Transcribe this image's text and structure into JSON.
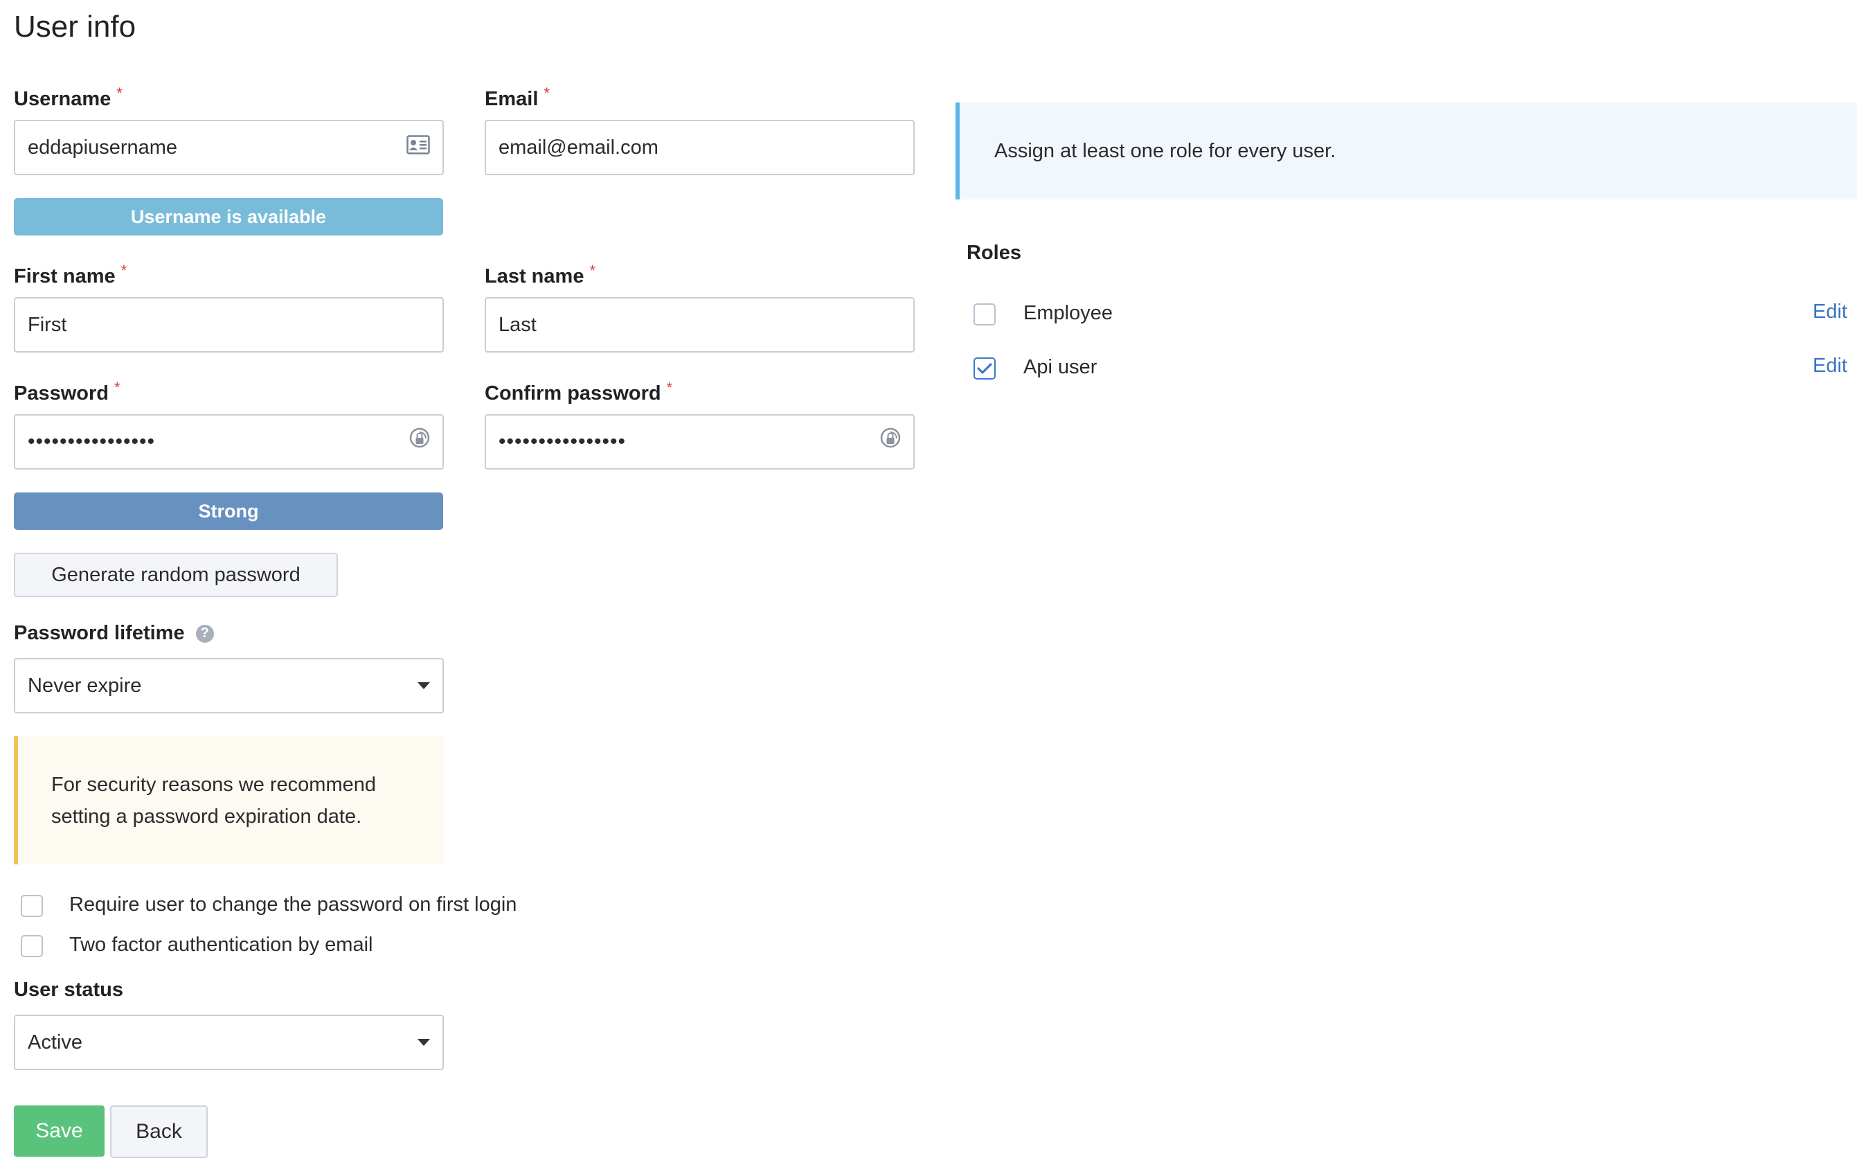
{
  "page": {
    "title": "User info"
  },
  "form": {
    "username": {
      "label": "Username",
      "value": "eddapiusername",
      "status": "Username is available"
    },
    "email": {
      "label": "Email",
      "value": "email@email.com"
    },
    "first_name": {
      "label": "First name",
      "value": "First"
    },
    "last_name": {
      "label": "Last name",
      "value": "Last"
    },
    "password": {
      "label": "Password",
      "value": "••••••••••••••••",
      "strength": "Strong"
    },
    "confirm_password": {
      "label": "Confirm password",
      "value": "••••••••••••••••"
    },
    "required_marker": "*",
    "generate_button": "Generate random password",
    "password_lifetime": {
      "label": "Password lifetime",
      "help_icon": "?",
      "selected": "Never expire"
    },
    "security_note_line1": "For security reasons we recommend",
    "security_note_line2": "setting a password expiration date.",
    "require_change": {
      "label": "Require user to change the password on first login",
      "checked": false
    },
    "two_factor": {
      "label": "Two factor authentication by email",
      "checked": false
    },
    "user_status": {
      "label": "User status",
      "selected": "Active"
    },
    "save_button": "Save",
    "back_button": "Back"
  },
  "roles_panel": {
    "info": "Assign at least one role for every user.",
    "title": "Roles",
    "roles": [
      {
        "name": "Employee",
        "checked": false,
        "edit_label": "Edit"
      },
      {
        "name": "Api user",
        "checked": true,
        "edit_label": "Edit"
      }
    ]
  },
  "colors": {
    "available_bar": "#79bcd9",
    "strong_bar": "#6792c0",
    "save_button": "#59c37c",
    "info_accent": "#5eb5e8",
    "warn_accent": "#ecc35c",
    "link": "#3a74c4"
  }
}
